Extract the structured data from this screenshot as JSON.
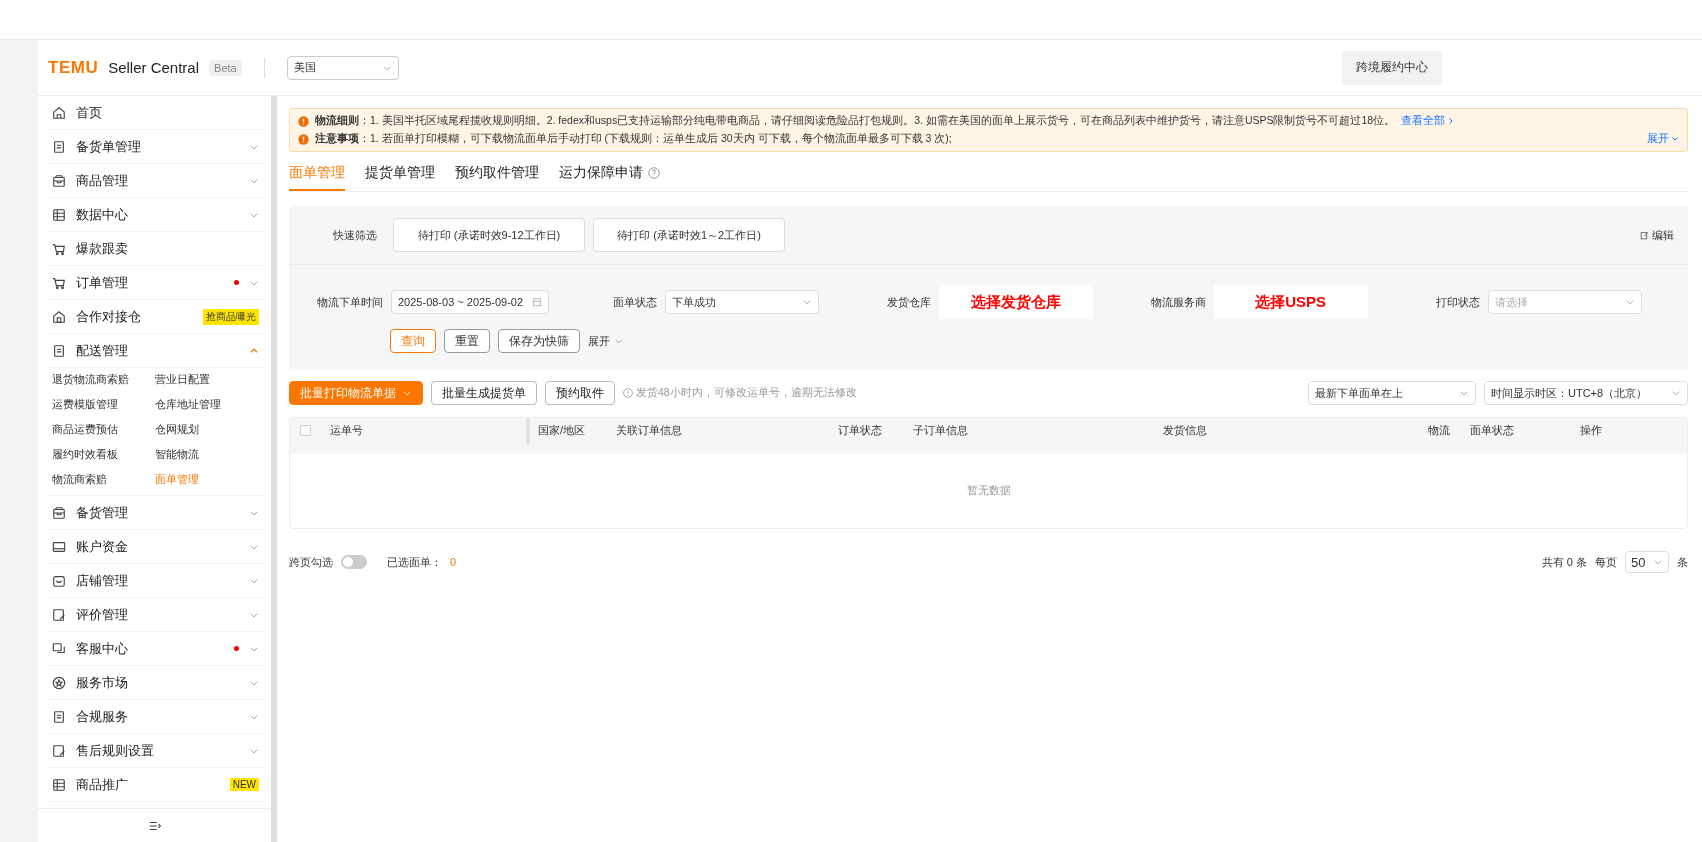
{
  "header": {
    "logo": "TEMU",
    "app_name": "Seller Central",
    "badge": "Beta",
    "region_select": "美国",
    "fulfillment_button": "跨境履约中心"
  },
  "sidebar": {
    "items": [
      {
        "label": "首页",
        "expandable": false,
        "expanded": false,
        "dot": false
      },
      {
        "label": "备货单管理",
        "expandable": true,
        "expanded": false,
        "dot": false
      },
      {
        "label": "商品管理",
        "expandable": true,
        "expanded": false,
        "dot": false
      },
      {
        "label": "数据中心",
        "expandable": true,
        "expanded": false,
        "dot": false
      },
      {
        "label": "爆款跟卖",
        "expandable": false,
        "expanded": false,
        "dot": false
      },
      {
        "label": "订单管理",
        "expandable": true,
        "expanded": false,
        "dot": true
      },
      {
        "label": "合作对接仓",
        "expandable": false,
        "expanded": false,
        "dot": false,
        "tag": "抢商品曝光"
      },
      {
        "label": "配送管理",
        "expandable": true,
        "expanded": true,
        "dot": false,
        "children": [
          {
            "label": "退货物流商索赔",
            "selected": false
          },
          {
            "label": "营业日配置",
            "selected": false
          },
          {
            "label": "运费模版管理",
            "selected": false
          },
          {
            "label": "仓库地址管理",
            "selected": false
          },
          {
            "label": "商品运费预估",
            "selected": false
          },
          {
            "label": "仓网规划",
            "selected": false
          },
          {
            "label": "履约时效看板",
            "selected": false
          },
          {
            "label": "智能物流",
            "selected": false
          },
          {
            "label": "物流商索赔",
            "selected": false
          },
          {
            "label": "面单管理",
            "selected": true
          }
        ]
      },
      {
        "label": "备货管理",
        "expandable": true,
        "expanded": false,
        "dot": false
      },
      {
        "label": "账户资金",
        "expandable": true,
        "expanded": false,
        "dot": false
      },
      {
        "label": "店铺管理",
        "expandable": true,
        "expanded": false,
        "dot": false
      },
      {
        "label": "评价管理",
        "expandable": true,
        "expanded": false,
        "dot": false
      },
      {
        "label": "客服中心",
        "expandable": true,
        "expanded": false,
        "dot": true
      },
      {
        "label": "服务市场",
        "expandable": true,
        "expanded": false,
        "dot": false
      },
      {
        "label": "合规服务",
        "expandable": true,
        "expanded": false,
        "dot": false
      },
      {
        "label": "售后规则设置",
        "expandable": true,
        "expanded": false,
        "dot": false
      },
      {
        "label": "商品推广",
        "expandable": false,
        "expanded": false,
        "dot": false,
        "tag": "NEW"
      }
    ]
  },
  "notice": {
    "lines": [
      {
        "text": "**物流细则**：1. 美国半托区域尾程揽收规则明细。2. fedex和usps已支持运输部分纯电带电商品，请仔细阅读危险品打包规则。3. 如需在美国的面单上展示货号，可在商品列表中维护货号，请注意USPS限制货号不可超过18位。",
        "link": "查看全部"
      },
      {
        "text": "**注意事项**：1. 若面单打印模糊，可下载物流面单后手动打印 (下载规则：运单生成后 30天内 可下载，每个物流面单最多可下载 3 次);",
        "link": "展开"
      }
    ]
  },
  "tabs": [
    {
      "label": "面单管理",
      "selected": true
    },
    {
      "label": "提货单管理",
      "selected": false
    },
    {
      "label": "预约取件管理",
      "selected": false
    },
    {
      "label": "运力保障申请",
      "selected": false,
      "help": true
    }
  ],
  "quick_filter": {
    "label": "快速筛选",
    "chips": [
      "待打印 (承诺时效9-12工作日)",
      "待打印 (承诺时效1～2工作日)"
    ],
    "edit_link": "编辑"
  },
  "filters": [
    {
      "label": "物流下单时间",
      "kind": "date",
      "value": "2025-08-03 ~ 2025-09-02"
    },
    {
      "label": "面单状态",
      "kind": "select",
      "value": "下单成功"
    },
    {
      "label": "发货仓库",
      "kind": "annotation",
      "value": "选择发货仓库"
    },
    {
      "label": "物流服务商",
      "kind": "annotation",
      "value": "选择USPS"
    },
    {
      "label": "打印状态",
      "kind": "select",
      "placeholder": "请选择"
    }
  ],
  "filter_buttons": [
    {
      "label": "查询",
      "kind": "primary"
    },
    {
      "label": "重置",
      "kind": "default"
    },
    {
      "label": "保存为快筛",
      "kind": "default"
    },
    {
      "label": "展开",
      "kind": "link"
    }
  ],
  "toolbar": {
    "buttons": [
      {
        "label": "批量打印物流单据",
        "kind": "primary"
      },
      {
        "label": "批量生成提货单",
        "kind": "default"
      },
      {
        "label": "预约取件",
        "kind": "default"
      }
    ],
    "hint": "发货48小时内，可修改运单号，逾期无法修改",
    "sort_select": "最新下单面单在上",
    "timezone_select": "时间显示时区：UTC+8（北京）"
  },
  "table": {
    "select_all_checked": false,
    "columns": [
      "运单号",
      "国家/地区",
      "关联订单信息",
      "订单状态",
      "子订单信息",
      "发货信息",
      "物流",
      "面单状态",
      "操作"
    ],
    "empty_text": "暂无数据"
  },
  "footer": {
    "cross_page_label": "跨页勾选",
    "cross_page_on": false,
    "selected_label": "已选面单：",
    "selected_count": "0",
    "total": "共有 0 条",
    "per_page_label": "每页",
    "per_page": "50",
    "per_page_unit": "条"
  }
}
